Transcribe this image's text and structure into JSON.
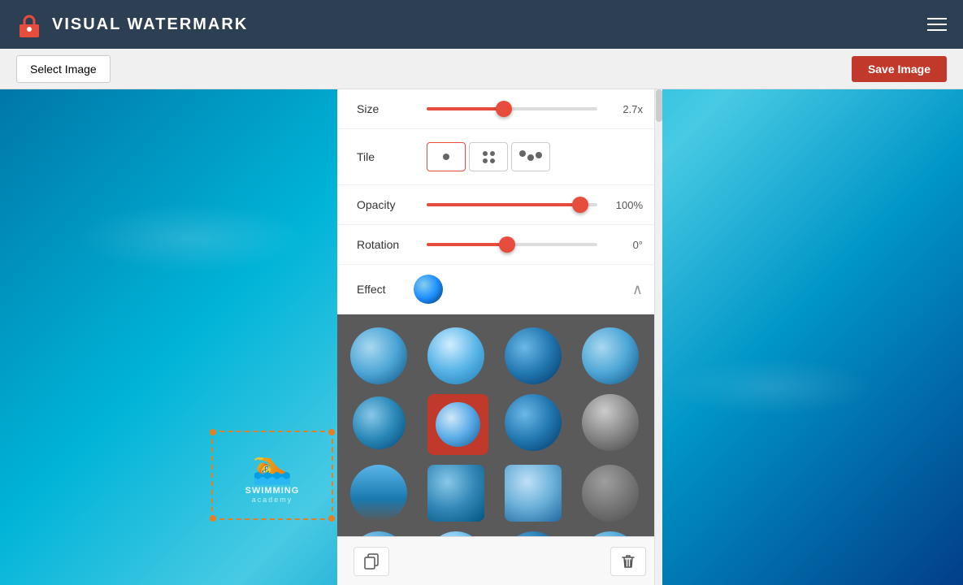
{
  "app": {
    "title": "VISUAL WATERMARK",
    "icon": "🔒"
  },
  "toolbar": {
    "select_image_label": "Select Image",
    "save_image_label": "Save Image"
  },
  "panel": {
    "size": {
      "label": "Size",
      "value": "2.7x",
      "percent": 45
    },
    "tile": {
      "label": "Tile",
      "options": [
        {
          "id": "single",
          "label": "single dot"
        },
        {
          "id": "grid",
          "label": "grid dots"
        },
        {
          "id": "scatter",
          "label": "scatter dots"
        }
      ],
      "selected": "single"
    },
    "opacity": {
      "label": "Opacity",
      "value": "100%",
      "percent": 90
    },
    "rotation": {
      "label": "Rotation",
      "value": "0°",
      "percent": 50
    },
    "effect": {
      "label": "Effect",
      "expanded": true,
      "items": [
        {
          "id": "e1",
          "style": "blue-gradient",
          "label": "Blue gradient"
        },
        {
          "id": "e2",
          "style": "light-blue",
          "label": "Light blue"
        },
        {
          "id": "e3",
          "style": "deep-blue",
          "label": "Deep blue"
        },
        {
          "id": "e4",
          "style": "blue-gradient2",
          "label": "Blue gradient 2"
        },
        {
          "id": "e5",
          "style": "partial-cut",
          "label": "Partial cut",
          "selected": true
        },
        {
          "id": "e6",
          "style": "white-center",
          "label": "White center"
        },
        {
          "id": "e7",
          "style": "dark-blue",
          "label": "Dark blue"
        },
        {
          "id": "e8",
          "style": "gray",
          "label": "Gray"
        },
        {
          "id": "e9",
          "style": "bottom-cut",
          "label": "Bottom cut"
        },
        {
          "id": "e10",
          "style": "blue-sq",
          "label": "Blue square"
        },
        {
          "id": "e11",
          "style": "light-sq",
          "label": "Light square"
        },
        {
          "id": "e12",
          "style": "gray2",
          "label": "Gray 2"
        },
        {
          "id": "e13",
          "style": "partial-sq",
          "label": "Partial square"
        },
        {
          "id": "e14",
          "style": "light-blue2",
          "label": "Light blue 2"
        },
        {
          "id": "e15",
          "style": "dark-sq",
          "label": "Dark square"
        },
        {
          "id": "e16",
          "style": "blue-sq2",
          "label": "Blue square 2"
        }
      ]
    }
  },
  "watermark": {
    "text_top": "SWIMMING",
    "text_bottom": "academy"
  },
  "buttons": {
    "copy_label": "⧉",
    "delete_label": "🗑"
  }
}
